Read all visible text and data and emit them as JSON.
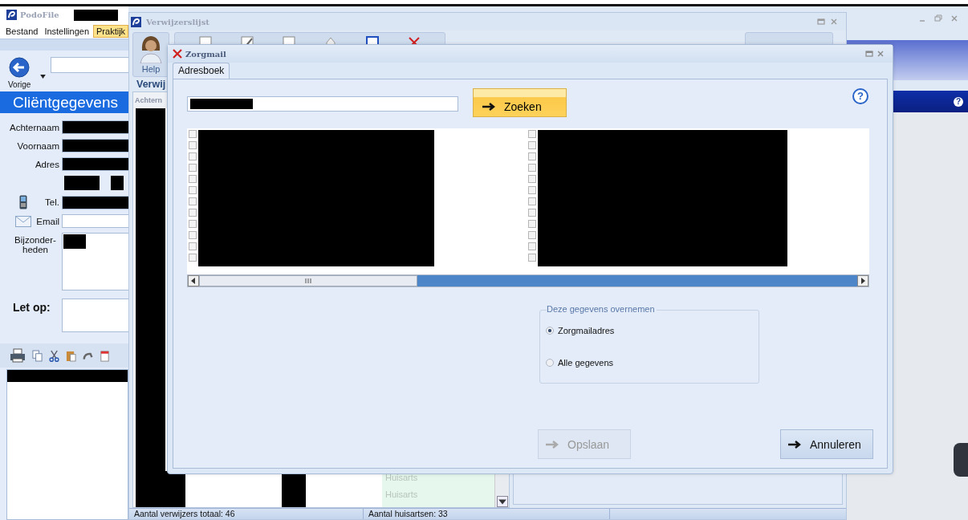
{
  "app": {
    "title": "PodoFile",
    "menu": [
      {
        "label": "Bestand",
        "selected": false
      },
      {
        "label": "Instellingen",
        "selected": false
      },
      {
        "label": "Praktijk",
        "selected": true
      }
    ],
    "back_label": "Vorige",
    "section_title": "Cliëntgegevens",
    "help_icon": "?",
    "fields": [
      {
        "label": "Achternaam",
        "kind": "redacted"
      },
      {
        "label": "Voornaam",
        "kind": "redacted"
      },
      {
        "label": "Adres",
        "kind": "redacted"
      },
      {
        "kind": "split"
      },
      {
        "label": "Tel.",
        "kind": "phone"
      },
      {
        "label": "Email",
        "kind": "email"
      },
      {
        "label": "Bijzonder-heden",
        "kind": "memo"
      }
    ],
    "note_label": "Let op:"
  },
  "list_window": {
    "title": "Verwijzerslijst",
    "help_label": "Help",
    "group_title": "Verwij",
    "column_header": "Achtern",
    "rows": [
      {
        "type": "Huisarts"
      },
      {
        "type": "Huisarts"
      }
    ],
    "status_bar": [
      "Aantal verwijzers totaal: 46",
      "Aantal huisartsen: 33"
    ]
  },
  "dialog": {
    "title": "Zorgmail",
    "tabs": [
      {
        "label": "Adresboek",
        "selected": true
      }
    ],
    "search_button": "Zoeken",
    "help_icon": "?",
    "columns": [
      {
        "rows": [
          {
            "checked": false
          },
          {
            "checked": false
          },
          {
            "checked": false
          },
          {
            "checked": false
          },
          {
            "checked": false
          },
          {
            "checked": false
          },
          {
            "checked": false
          },
          {
            "checked": false
          },
          {
            "checked": false
          },
          {
            "checked": false
          },
          {
            "checked": false
          },
          {
            "checked": false
          }
        ]
      },
      {
        "rows": [
          {
            "checked": false
          },
          {
            "checked": false
          },
          {
            "checked": false
          },
          {
            "checked": false
          },
          {
            "checked": false
          },
          {
            "checked": false
          },
          {
            "checked": false
          },
          {
            "checked": false
          },
          {
            "checked": false
          },
          {
            "checked": false
          },
          {
            "checked": false
          },
          {
            "checked": false
          }
        ]
      }
    ],
    "group": {
      "title": "Deze gegevens overnemen",
      "options": [
        {
          "label": "Zorgmailadres",
          "selected": true
        },
        {
          "label": "Alle gegevens",
          "selected": false
        }
      ]
    },
    "buttons": [
      {
        "label": "Opslaan",
        "disabled": true
      },
      {
        "label": "Annuleren",
        "disabled": false
      }
    ]
  }
}
